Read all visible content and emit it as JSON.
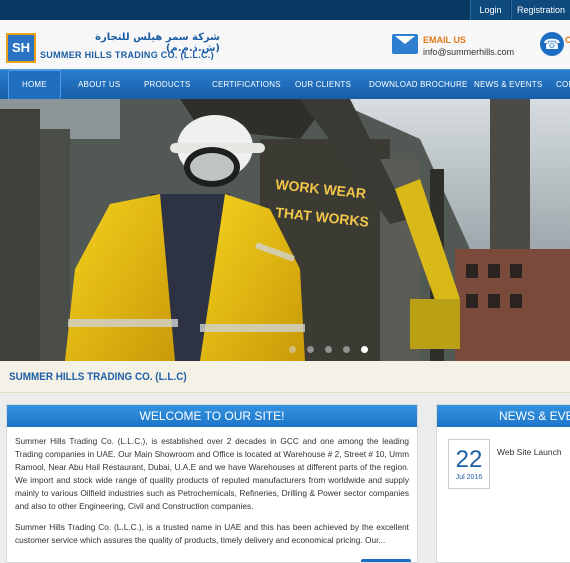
{
  "topbar": {
    "login": "Login",
    "register": "Registration"
  },
  "header": {
    "logo_mark": "SH",
    "logo_arabic": "شركة سمر هيلس للتجارة (ش.ذ.م.م)",
    "logo_english": "SUMMER HILLS TRADING CO. (L.L.C.)",
    "email_label": "EMAIL US",
    "email_value": "info@summerhills.com",
    "phone_fragment": "C"
  },
  "nav": {
    "items": [
      {
        "label": "HOME",
        "active": true
      },
      {
        "label": "ABOUT US"
      },
      {
        "label": "PRODUCTS"
      },
      {
        "label": "CERTIFICATIONS"
      },
      {
        "label": "OUR CLIENTS"
      },
      {
        "label": "DOWNLOAD BROCHURE"
      },
      {
        "label": "NEWS & EVENTS"
      },
      {
        "label": "CONT"
      }
    ]
  },
  "hero": {
    "sign_line1": "WORK WEAR",
    "sign_line2": "THAT WORKS",
    "slides": 5,
    "active_slide": 5
  },
  "company_bar": {
    "name": "SUMMER HILLS TRADING CO. (L.L.C)"
  },
  "welcome": {
    "title": "WELCOME TO OUR SITE!",
    "para1": "Summer Hills Trading Co. (L.L.C.), is established over 2 decades in GCC and one among the leading Trading companies in UAE. Our Main Showroom and Office is located at Warehouse # 2, Street # 10, Umm Ramool, Near Abu Hail Restaurant, Dubai, U.A.E and we have Warehouses at different parts of the region. We import and stock wide range of quality products of reputed manufacturers from worldwide and supply mainly to various Oilfield industries such as Petrochemicals, Refineries, Drilling & Power sector companies and also to other Engineering, Civil and Construction companies.",
    "para2": "Summer Hills Trading Co. (L.L.C.), is a trusted name in UAE and this has been achieved by the excellent customer service which assures the quality of products, timely delivery and economical pricing. Our..."
  },
  "news": {
    "title": "NEWS & EVENTS",
    "items": [
      {
        "day": "22",
        "month": "Jul 2016",
        "title": "Web Site Launch"
      }
    ]
  },
  "colors": {
    "brand_blue": "#1d6ec2",
    "topbar": "#0a3a63",
    "accent_orange": "#e07a1a"
  }
}
